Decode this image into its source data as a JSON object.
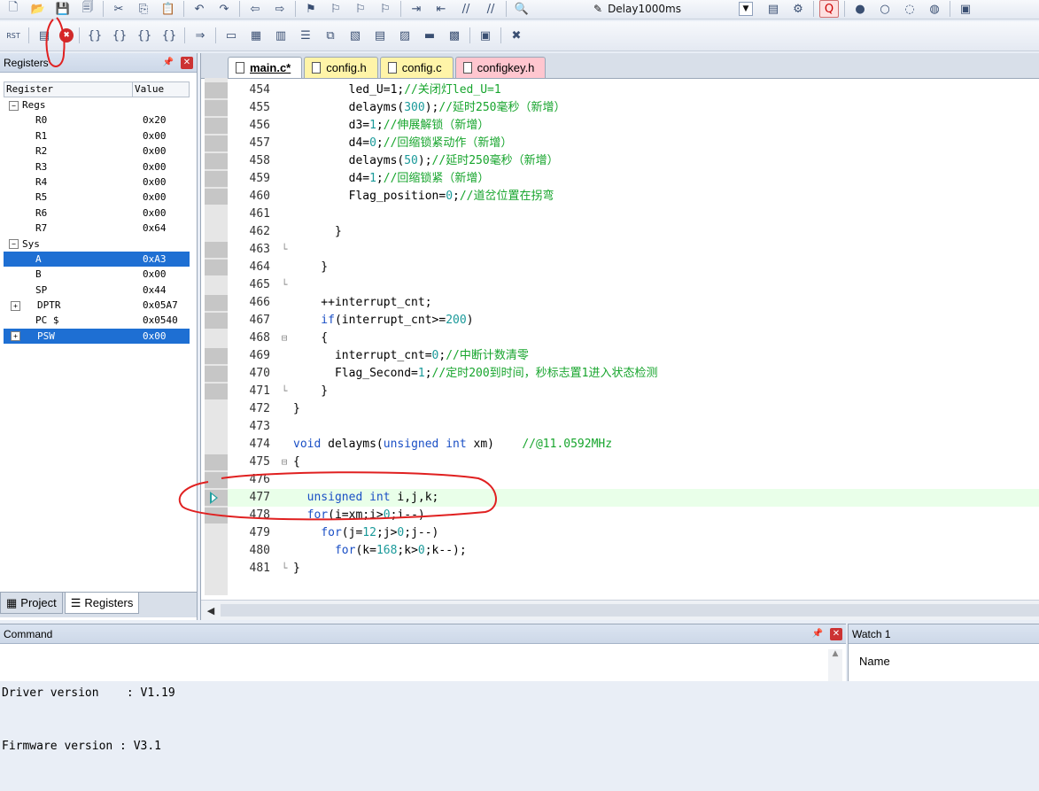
{
  "toolbar_top": {
    "items": [
      {
        "icon": "new-file-icon"
      },
      {
        "icon": "open-folder-icon"
      },
      {
        "icon": "save-icon"
      },
      {
        "icon": "save-all-icon"
      },
      {
        "icon": "cut-icon"
      },
      {
        "icon": "copy-icon"
      },
      {
        "icon": "paste-icon"
      },
      {
        "icon": "undo-icon"
      },
      {
        "icon": "redo-icon"
      },
      {
        "icon": "back-icon"
      },
      {
        "icon": "forward-icon"
      },
      {
        "icon": "bookmark-icon"
      },
      {
        "icon": "prev-bookmark-icon"
      },
      {
        "icon": "next-bookmark-icon"
      },
      {
        "icon": "clear-bookmarks-icon"
      },
      {
        "icon": "indent-icon"
      },
      {
        "icon": "unindent-icon"
      },
      {
        "icon": "comment-icon"
      },
      {
        "icon": "uncomment-icon"
      },
      {
        "icon": "find-in-files-icon"
      }
    ],
    "find_combo": "Delay1000ms"
  },
  "toolbar_debug": {
    "items": [
      {
        "icon": "reset-icon",
        "glyph": "RST"
      },
      {
        "icon": "run-icon"
      },
      {
        "icon": "stop-icon"
      },
      {
        "icon": "step-into-icon"
      },
      {
        "icon": "step-over-icon"
      },
      {
        "icon": "step-out-icon"
      },
      {
        "icon": "run-to-cursor-icon"
      },
      {
        "icon": "show-next-statement-icon"
      },
      {
        "icon": "command-window-icon"
      },
      {
        "icon": "disassembly-window-icon"
      },
      {
        "icon": "symbols-window-icon"
      },
      {
        "icon": "registers-window-icon"
      },
      {
        "icon": "call-stack-icon"
      },
      {
        "icon": "watch-window-icon"
      },
      {
        "icon": "memory-window-icon"
      },
      {
        "icon": "serial-window-icon"
      },
      {
        "icon": "analysis-window-icon"
      },
      {
        "icon": "trace-window-icon"
      },
      {
        "icon": "system-viewer-icon"
      },
      {
        "icon": "toolbox-icon"
      }
    ]
  },
  "registers_panel": {
    "title": "Registers",
    "col_register": "Register",
    "col_value": "Value",
    "rows": [
      {
        "name": "Regs",
        "value": "",
        "level": 0,
        "expander": "−"
      },
      {
        "name": "R0",
        "value": "0x20",
        "level": 1
      },
      {
        "name": "R1",
        "value": "0x00",
        "level": 1
      },
      {
        "name": "R2",
        "value": "0x00",
        "level": 1
      },
      {
        "name": "R3",
        "value": "0x00",
        "level": 1
      },
      {
        "name": "R4",
        "value": "0x00",
        "level": 1
      },
      {
        "name": "R5",
        "value": "0x00",
        "level": 1
      },
      {
        "name": "R6",
        "value": "0x00",
        "level": 1
      },
      {
        "name": "R7",
        "value": "0x64",
        "level": 1
      },
      {
        "name": "Sys",
        "value": "",
        "level": 0,
        "expander": "−"
      },
      {
        "name": "A",
        "value": "0xA3",
        "level": 1,
        "selected": true
      },
      {
        "name": "B",
        "value": "0x00",
        "level": 1
      },
      {
        "name": "SP",
        "value": "0x44",
        "level": 1
      },
      {
        "name": "DPTR",
        "value": "0x05A7",
        "level": 1,
        "expander": "+"
      },
      {
        "name": "PC $",
        "value": "0x0540",
        "level": 1
      },
      {
        "name": "PSW",
        "value": "0x00",
        "level": 1,
        "expander": "+",
        "selected": true
      }
    ],
    "tab_project": "Project",
    "tab_registers": "Registers"
  },
  "editor": {
    "tabs": [
      {
        "label": "main.c*",
        "style": "main"
      },
      {
        "label": "config.h",
        "style": "yellow"
      },
      {
        "label": "config.c",
        "style": "yellow"
      },
      {
        "label": "configkey.h",
        "style": "pink"
      }
    ],
    "current_line": 477,
    "lines": [
      {
        "n": "454",
        "fold": "",
        "bp": true,
        "segs": [
          [
            "",
            "        led_U=1;"
          ],
          [
            "cm",
            "//关闭灯led_U=1"
          ]
        ]
      },
      {
        "n": "455",
        "fold": "",
        "bp": true,
        "segs": [
          [
            "",
            "        delayms("
          ],
          [
            "num",
            "300"
          ],
          [
            "",
            ");"
          ],
          [
            "cm",
            "//延时250毫秒（新增）"
          ]
        ]
      },
      {
        "n": "456",
        "fold": "",
        "bp": true,
        "segs": [
          [
            "",
            "        d3="
          ],
          [
            "num",
            "1"
          ],
          [
            "",
            ";"
          ],
          [
            "cm",
            "//伸展解锁（新增）"
          ]
        ]
      },
      {
        "n": "457",
        "fold": "",
        "bp": true,
        "segs": [
          [
            "",
            "        d4="
          ],
          [
            "num",
            "0"
          ],
          [
            "",
            ";"
          ],
          [
            "cm",
            "//回缩锁紧动作（新增）"
          ]
        ]
      },
      {
        "n": "458",
        "fold": "",
        "bp": true,
        "segs": [
          [
            "",
            "        delayms("
          ],
          [
            "num",
            "50"
          ],
          [
            "",
            ");"
          ],
          [
            "cm",
            "//延时250毫秒（新增）"
          ]
        ]
      },
      {
        "n": "459",
        "fold": "",
        "bp": true,
        "segs": [
          [
            "",
            "        d4="
          ],
          [
            "num",
            "1"
          ],
          [
            "",
            ";"
          ],
          [
            "cm",
            "//回缩锁紧（新增）"
          ]
        ]
      },
      {
        "n": "460",
        "fold": "",
        "bp": true,
        "segs": [
          [
            "",
            "        Flag_position="
          ],
          [
            "num",
            "0"
          ],
          [
            "",
            ";"
          ],
          [
            "cm",
            "//道岔位置在拐弯"
          ]
        ]
      },
      {
        "n": "461",
        "fold": "",
        "bp": false,
        "segs": [
          [
            "",
            ""
          ]
        ]
      },
      {
        "n": "462",
        "fold": "",
        "bp": false,
        "segs": [
          [
            "",
            "      }"
          ]
        ]
      },
      {
        "n": "463",
        "fold": "└",
        "bp": true,
        "segs": [
          [
            "",
            ""
          ]
        ]
      },
      {
        "n": "464",
        "fold": "",
        "bp": true,
        "segs": [
          [
            "",
            "    }"
          ]
        ]
      },
      {
        "n": "465",
        "fold": "└",
        "bp": false,
        "segs": [
          [
            "",
            ""
          ]
        ]
      },
      {
        "n": "466",
        "fold": "",
        "bp": true,
        "segs": [
          [
            "",
            "    ++interrupt_cnt;"
          ]
        ]
      },
      {
        "n": "467",
        "fold": "",
        "bp": true,
        "segs": [
          [
            "kw",
            "    if"
          ],
          [
            "",
            "(interrupt_cnt>="
          ],
          [
            "num",
            "200"
          ],
          [
            "",
            ")"
          ]
        ]
      },
      {
        "n": "468",
        "fold": "⊟",
        "bp": false,
        "segs": [
          [
            "",
            "    {"
          ]
        ]
      },
      {
        "n": "469",
        "fold": "",
        "bp": true,
        "segs": [
          [
            "",
            "      interrupt_cnt="
          ],
          [
            "num",
            "0"
          ],
          [
            "",
            ";"
          ],
          [
            "cm",
            "//中断计数清零"
          ]
        ]
      },
      {
        "n": "470",
        "fold": "",
        "bp": true,
        "segs": [
          [
            "",
            "      Flag_Second="
          ],
          [
            "num",
            "1"
          ],
          [
            "",
            ";"
          ],
          [
            "cm",
            "//定时200到时间，秒标志置1进入状态检测"
          ]
        ]
      },
      {
        "n": "471",
        "fold": "└",
        "bp": true,
        "segs": [
          [
            "",
            "    }"
          ]
        ]
      },
      {
        "n": "472",
        "fold": "",
        "bp": false,
        "segs": [
          [
            "",
            "}"
          ]
        ]
      },
      {
        "n": "473",
        "fold": "",
        "bp": false,
        "segs": [
          [
            "",
            ""
          ]
        ]
      },
      {
        "n": "474",
        "fold": "",
        "bp": false,
        "segs": [
          [
            "kw",
            "void"
          ],
          [
            "",
            " delayms("
          ],
          [
            "kw",
            "unsigned int"
          ],
          [
            "",
            " xm)    "
          ],
          [
            "cm",
            "//@11.0592MHz"
          ]
        ]
      },
      {
        "n": "475",
        "fold": "⊟",
        "bp": true,
        "segs": [
          [
            "",
            "{"
          ]
        ]
      },
      {
        "n": "476",
        "fold": "",
        "bp": true,
        "segs": [
          [
            "",
            ""
          ]
        ]
      },
      {
        "n": "477",
        "fold": "",
        "bp": true,
        "segs": [
          [
            "kw",
            "  unsigned int"
          ],
          [
            "",
            " i,j,k;"
          ]
        ]
      },
      {
        "n": "478",
        "fold": "",
        "bp": true,
        "segs": [
          [
            "kw",
            "  for"
          ],
          [
            "",
            "(i=xm;i>"
          ],
          [
            "num",
            "0"
          ],
          [
            "",
            ";i--)"
          ]
        ]
      },
      {
        "n": "479",
        "fold": "",
        "bp": false,
        "segs": [
          [
            "kw",
            "    for"
          ],
          [
            "",
            "(j="
          ],
          [
            "num",
            "12"
          ],
          [
            "",
            ";j>"
          ],
          [
            "num",
            "0"
          ],
          [
            "",
            ";j--)"
          ]
        ]
      },
      {
        "n": "480",
        "fold": "",
        "bp": false,
        "segs": [
          [
            "kw",
            "      for"
          ],
          [
            "",
            "(k="
          ],
          [
            "num",
            "168"
          ],
          [
            "",
            ";k>"
          ],
          [
            "num",
            "0"
          ],
          [
            "",
            ";k--);"
          ]
        ]
      },
      {
        "n": "481",
        "fold": "└",
        "bp": false,
        "segs": [
          [
            "",
            "}"
          ]
        ]
      }
    ]
  },
  "command_panel": {
    "title": "Command",
    "lines": [
      "Driver version    : V1.19",
      "Firmware version : V3.1"
    ]
  },
  "watch_panel": {
    "title": "Watch 1",
    "col_name": "Name"
  }
}
